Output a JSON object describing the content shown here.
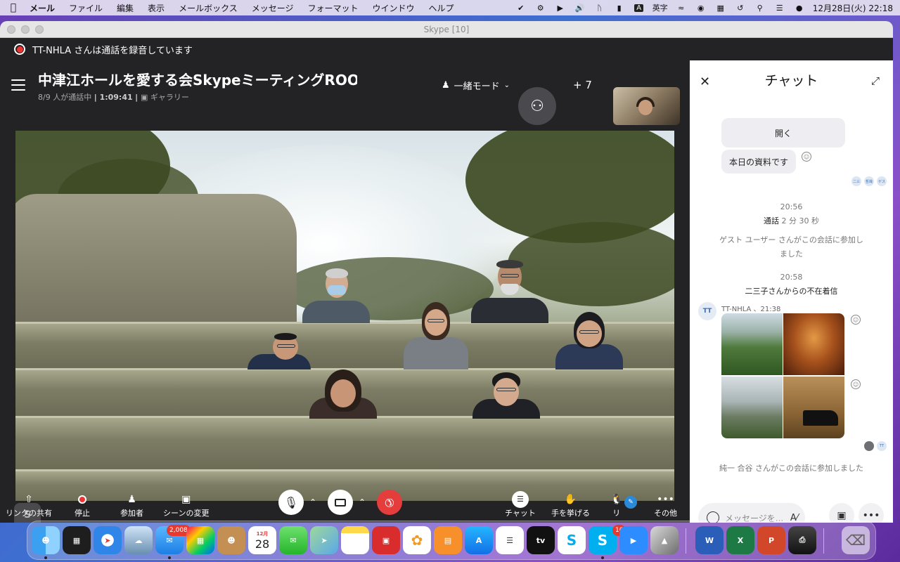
{
  "menubar": {
    "app_name": "メール",
    "items": [
      "ファイル",
      "編集",
      "表示",
      "メールボックス",
      "メッセージ",
      "フォーマット",
      "ウインドウ",
      "ヘルプ"
    ],
    "ime_mark": "A",
    "ime_label": "英字",
    "clock": "12月28日(火)  22:18"
  },
  "window": {
    "title": "Skype [10]"
  },
  "recording": {
    "notice": "TT-NHLA さんは通話を録音しています"
  },
  "call": {
    "title": "中津江ホールを愛する会SkypeミーティングROOM",
    "participants": "8/9 人が通話中",
    "duration": "1:09:41",
    "view_label": "ギャラリー",
    "mode_label": "一緒モード",
    "extra_count": "+ 7"
  },
  "controls": {
    "share_link": "リンクの共有",
    "stop": "停止",
    "participants": "参加者",
    "change_scene": "シーンの変更",
    "chat": "チャット",
    "raise_hand": "手を挙げる",
    "reactions": "リ",
    "more": "その他"
  },
  "chat": {
    "title": "チャット",
    "bubble_open": "開く",
    "bubble_materials": "本日の資料です",
    "read_avatars": [
      "二三",
      "哲哉",
      "ゲス"
    ],
    "time1": "20:56",
    "call_label": "通話",
    "call_length": "2 分 30 秒",
    "guest_joined": "ゲスト ユーザー さんがこの会話に参加しました",
    "time2": "20:58",
    "missed_call": "二三子さんからの不在着信",
    "sender_initials": "TT",
    "sender_line": "TT-NHLA 、21:38",
    "read_tt": "TT",
    "member_joined": "純一 合谷 さんがこの会話に参加しました",
    "input_placeholder": "メッセージを..."
  },
  "dock": {
    "mail_badge": "2,008",
    "calendar_month": "12月",
    "calendar_day": "28",
    "tv_label": "tv",
    "skype_badge": "10"
  },
  "colors": {
    "recording_red": "#e33333",
    "hangup_red": "#e53c3c",
    "skype_blue": "#00aff0"
  }
}
